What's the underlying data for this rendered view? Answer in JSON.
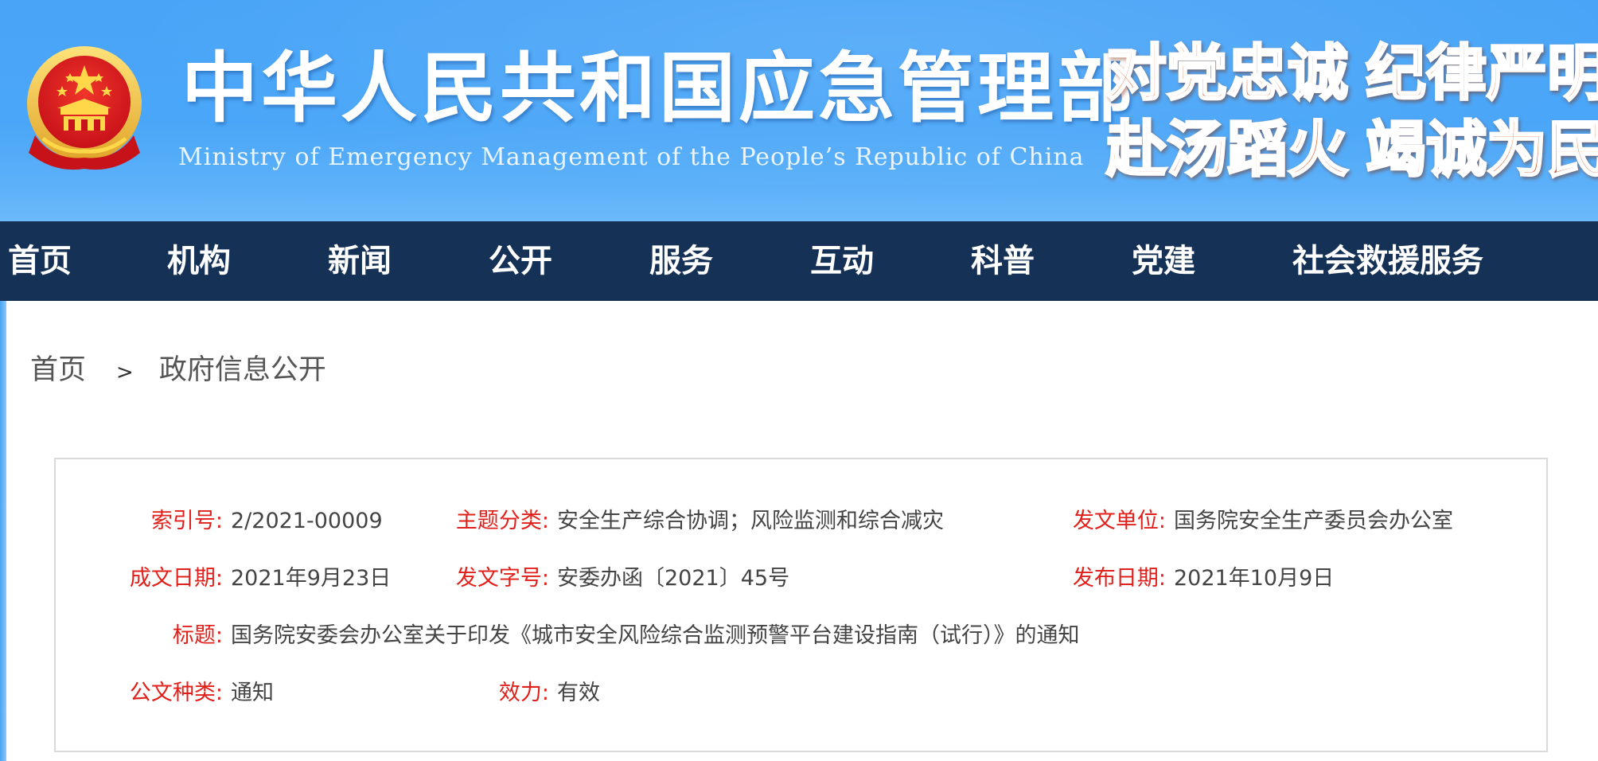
{
  "header": {
    "title": "中华人民共和国应急管理部",
    "subtitle": "Ministry of Emergency Management of the People’s Republic of China",
    "slogan": [
      "对党忠诚",
      "纪律严明",
      "赴汤蹈火",
      "竭诚为民"
    ]
  },
  "nav": {
    "items": [
      {
        "label": "首页"
      },
      {
        "label": "机构"
      },
      {
        "label": "新闻"
      },
      {
        "label": "公开"
      },
      {
        "label": "服务"
      },
      {
        "label": "互动"
      },
      {
        "label": "科普"
      },
      {
        "label": "党建"
      },
      {
        "label": "社会救援服务"
      }
    ]
  },
  "breadcrumb": {
    "home": "首页",
    "separator": ">",
    "current": "政府信息公开"
  },
  "meta": {
    "index_no": {
      "label": "索引号:",
      "value": "2/2021-00009"
    },
    "topic": {
      "label": "主题分类:",
      "value": "安全生产综合协调；风险监测和综合减灾"
    },
    "issuer": {
      "label": "发文单位:",
      "value": "国务院安全生产委员会办公室"
    },
    "written_date": {
      "label": "成文日期:",
      "value": "2021年9月23日"
    },
    "doc_no": {
      "label": "发文字号:",
      "value": "安委办函〔2021〕45号"
    },
    "publish_date": {
      "label": "发布日期:",
      "value": "2021年10月9日"
    },
    "title": {
      "label": "标题:",
      "value": "国务院安委会办公室关于印发《城市安全风险综合监测预警平台建设指南（试行）》的通知"
    },
    "doc_type": {
      "label": "公文种类:",
      "value": "通知"
    },
    "validity": {
      "label": "效力:",
      "value": "有效"
    }
  },
  "colors": {
    "header_blue": "#4aa6f8",
    "nav_navy": "#163156",
    "label_red": "#e2201b",
    "slogan_orange": "#e46a3a"
  }
}
